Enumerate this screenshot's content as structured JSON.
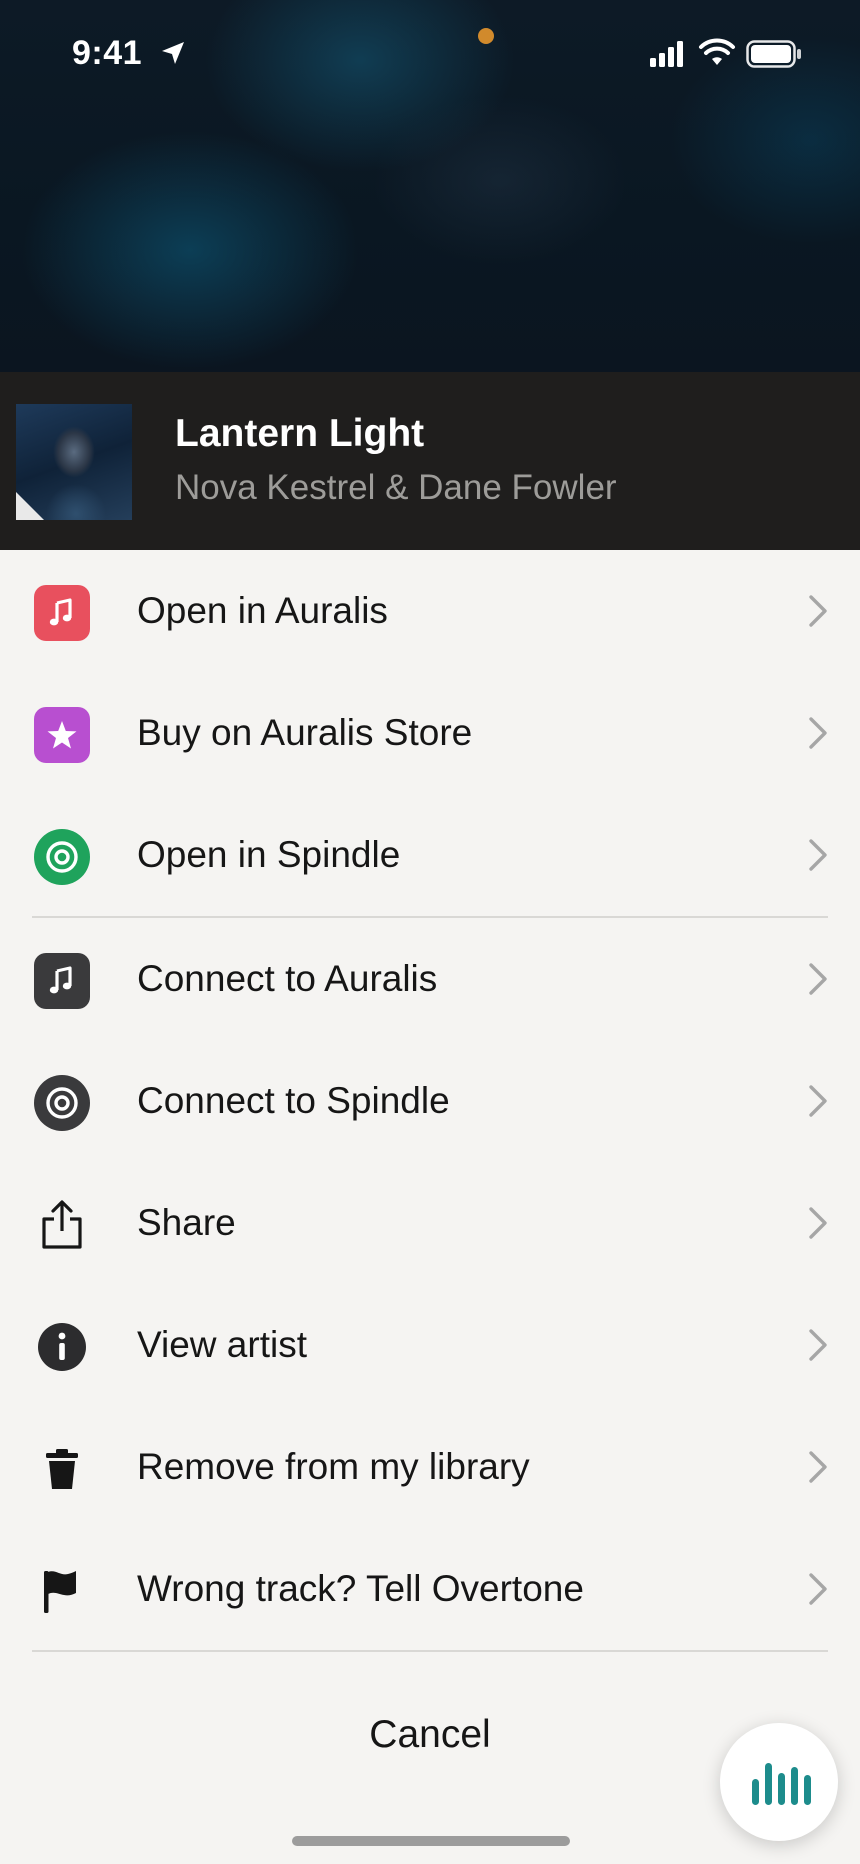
{
  "status_bar": {
    "time": "9:41",
    "icons": [
      "location-arrow-icon",
      "signal-icon",
      "wifi-icon",
      "battery-icon"
    ]
  },
  "track": {
    "title": "Lantern Light",
    "artist": "Nova Kestrel & Dane Fowler"
  },
  "menu": {
    "items": [
      {
        "label": "Open in Auralis",
        "icon": "music-note-icon",
        "color": "#e8505e"
      },
      {
        "label": "Buy on Auralis Store",
        "icon": "star-icon",
        "color": "#b84fd0"
      },
      {
        "label": "Open in Spindle",
        "icon": "spindle-icon",
        "color": "#1fa35c"
      },
      {
        "label": "Connect to Auralis",
        "icon": "music-note-icon",
        "color": "#3a3a3c"
      },
      {
        "label": "Connect to Spindle",
        "icon": "spindle-icon",
        "color": "#3a3a3c"
      },
      {
        "label": "Share",
        "icon": "share-icon",
        "color": "#161616"
      },
      {
        "label": "View artist",
        "icon": "info-icon",
        "color": "#2c2c2e"
      },
      {
        "label": "Remove from my library",
        "icon": "trash-icon",
        "color": "#161616"
      },
      {
        "label": "Wrong track? Tell Overtone",
        "icon": "flag-icon",
        "color": "#161616"
      }
    ],
    "cancel_label": "Cancel"
  },
  "fab": {
    "icon": "equalizer-icon",
    "color": "#1d8c8c"
  }
}
